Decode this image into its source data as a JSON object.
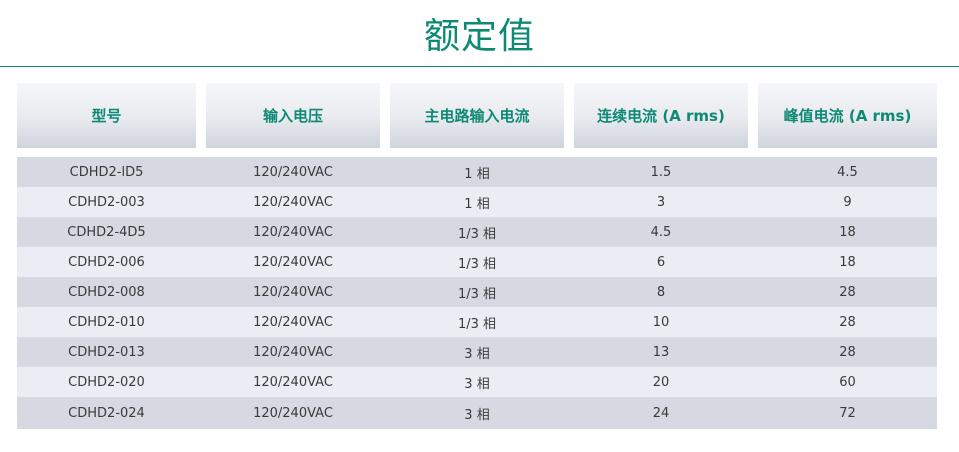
{
  "title": "额定值",
  "table": {
    "headers": [
      "型号",
      "输入电压",
      "主电路输入电流",
      "连续电流 (A rms)",
      "峰值电流 (A rms)"
    ],
    "rows": [
      [
        "CDHD2-lD5",
        "120/240VAC",
        "1 相",
        "1.5",
        "4.5"
      ],
      [
        "CDHD2-003",
        "120/240VAC",
        "1 相",
        "3",
        "9"
      ],
      [
        "CDHD2-4D5",
        "120/240VAC",
        "1/3 相",
        "4.5",
        "18"
      ],
      [
        "CDHD2-006",
        "120/240VAC",
        "1/3 相",
        "6",
        "18"
      ],
      [
        "CDHD2-008",
        "120/240VAC",
        "1/3 相",
        "8",
        "28"
      ],
      [
        "CDHD2-010",
        "120/240VAC",
        "1/3 相",
        "10",
        "28"
      ],
      [
        "CDHD2-013",
        "120/240VAC",
        "3 相",
        "13",
        "28"
      ],
      [
        "CDHD2-020",
        "120/240VAC",
        "3 相",
        "20",
        "60"
      ],
      [
        "CDHD2-024",
        "120/240VAC",
        "3 相",
        "24",
        "72"
      ]
    ]
  },
  "colors": {
    "accent": "#0e8a74",
    "row_odd": "#d6d9e2",
    "row_even": "#eaedf4"
  }
}
